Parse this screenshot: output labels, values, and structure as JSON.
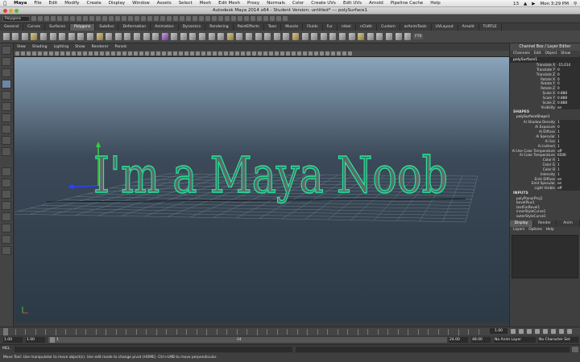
{
  "mac_menu": {
    "items": [
      "Maya",
      "File",
      "Edit",
      "Modify",
      "Create",
      "Display",
      "Window",
      "Assets",
      "Select",
      "Mesh",
      "Edit Mesh",
      "Proxy",
      "Normals",
      "Color",
      "Create UVs",
      "Edit UVs",
      "Arnold",
      "Pipeline Cache",
      "Help"
    ],
    "status_number": "13",
    "clock": "Mon 3:29 PM"
  },
  "window_title": "Autodesk Maya 2014 x64 - Student Version: untitled* --- polySurface1",
  "status_line": {
    "mode": "Polygons"
  },
  "shelf": {
    "tabs": [
      "General",
      "Curves",
      "Surfaces",
      "Polygons",
      "Subdivs",
      "Deformation",
      "Animation",
      "Dynamics",
      "Rendering",
      "PaintEffects",
      "Toon",
      "Muscle",
      "Fluids",
      "Fur",
      "nHair",
      "nCloth",
      "Custom",
      "arAnimTools",
      "UVLayout",
      "Arnold",
      "TURTLE"
    ],
    "active_tab": 3,
    "last_icon_label": "FTX"
  },
  "panel_menu": [
    "View",
    "Shading",
    "Lighting",
    "Show",
    "Renderer",
    "Panels"
  ],
  "viewport": {
    "text": "I'm a Maya Noob",
    "colors": {
      "text_fill": "#5e6a67",
      "text_edge": "#22e59a",
      "manip_x": "#2f3fff",
      "manip_y": "#35d13a"
    }
  },
  "channel_box": {
    "header": "Channel Box / Layer Editor",
    "menu": [
      "Channels",
      "Edit",
      "Object",
      "Show"
    ],
    "object": "polySurface1",
    "transform": [
      {
        "name": "Translate X",
        "value": "-15.014"
      },
      {
        "name": "Translate Y",
        "value": "0"
      },
      {
        "name": "Translate Z",
        "value": "0"
      },
      {
        "name": "Rotate X",
        "value": "0"
      },
      {
        "name": "Rotate Y",
        "value": "0"
      },
      {
        "name": "Rotate Z",
        "value": "0"
      },
      {
        "name": "Scale X",
        "value": "0.888"
      },
      {
        "name": "Scale Y",
        "value": "0.888"
      },
      {
        "name": "Scale Z",
        "value": "0.888"
      },
      {
        "name": "Visibility",
        "value": "on"
      }
    ],
    "shapes_label": "SHAPES",
    "shape_name": "polySurfaceShape1",
    "shape_attrs": [
      {
        "name": "Ai Shadow Density",
        "value": "1"
      },
      {
        "name": "Ai Exposure",
        "value": "0"
      },
      {
        "name": "Ai Diffuse",
        "value": "1"
      },
      {
        "name": "Ai Specular",
        "value": "1"
      },
      {
        "name": "Ai Sss",
        "value": "1"
      },
      {
        "name": "Ai Indirect",
        "value": "1"
      },
      {
        "name": "Ai Use Color Temperature",
        "value": "off"
      },
      {
        "name": "Ai Color Temperature",
        "value": "6500"
      },
      {
        "name": "Color R",
        "value": "1"
      },
      {
        "name": "Color G",
        "value": "1"
      },
      {
        "name": "Color B",
        "value": "1"
      },
      {
        "name": "Intensity",
        "value": "1"
      },
      {
        "name": "Emit Diffuse",
        "value": "on"
      },
      {
        "name": "Emit Specular",
        "value": "on"
      },
      {
        "name": "Light Visible",
        "value": "off"
      }
    ],
    "inputs_label": "INPUTS",
    "inputs": [
      "polyPlanarProj1",
      "bevelPlus1",
      "textForBevel1",
      "innerStyleCurve1",
      "outerStyleCurve1"
    ]
  },
  "layer_editor": {
    "tabs": [
      "Display",
      "Render",
      "Anim"
    ],
    "active_tab": 0,
    "menu": [
      "Layers",
      "Options",
      "Help"
    ]
  },
  "time_slider": {
    "current_frame": "1.00"
  },
  "range_slider": {
    "start": "1.00",
    "playback_start": "1.00",
    "range_start": "1",
    "range_end": "24",
    "playback_end": "24.00",
    "end": "48.00",
    "anim_layer": "No Anim Layer",
    "character_set": "No Character Set"
  },
  "command_line": {
    "label": "MEL"
  },
  "help_line": "Move Tool: Use manipulator to move object(s). Use edit mode to change pivot (HOME). Ctrl+LMB to move perpendicular."
}
